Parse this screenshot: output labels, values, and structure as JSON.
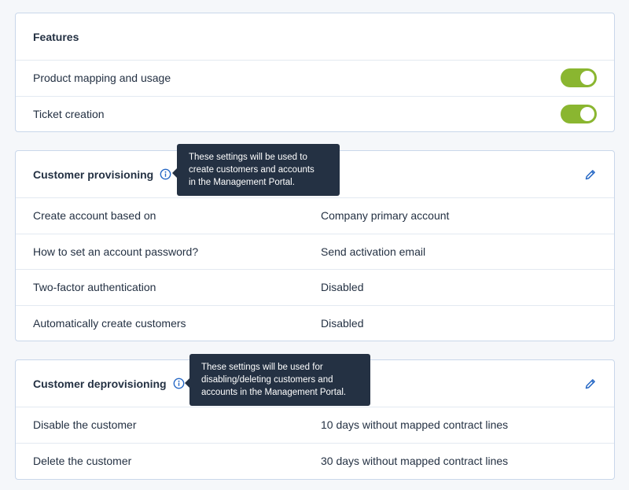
{
  "features": {
    "title": "Features",
    "rows": [
      {
        "label": "Product mapping and usage",
        "enabled": true
      },
      {
        "label": "Ticket creation",
        "enabled": true
      }
    ]
  },
  "provisioning": {
    "title": "Customer provisioning",
    "tooltip_lines": [
      "These settings will be used to",
      "create customers and accounts",
      "in the Management Portal."
    ],
    "rows": [
      {
        "label": "Create account based on",
        "value": "Company primary account"
      },
      {
        "label": "How to set an account password?",
        "value": "Send activation email"
      },
      {
        "label": "Two-factor authentication",
        "value": "Disabled"
      },
      {
        "label": "Automatically create customers",
        "value": "Disabled"
      }
    ]
  },
  "deprovisioning": {
    "title": "Customer deprovisioning",
    "tooltip_lines": [
      "These settings will be used for",
      "disabling/deleting customers and",
      "accounts in the Management Portal."
    ],
    "rows": [
      {
        "label": "Disable the customer",
        "value": "10 days without mapped contract lines"
      },
      {
        "label": "Delete the customer",
        "value": "30 days without mapped contract lines"
      }
    ]
  },
  "colors": {
    "toggle_on": "#8ab630",
    "accent_blue": "#2668c5",
    "tooltip_bg": "#243143"
  },
  "icons": {
    "info": "info-icon",
    "edit": "pencil-icon"
  }
}
